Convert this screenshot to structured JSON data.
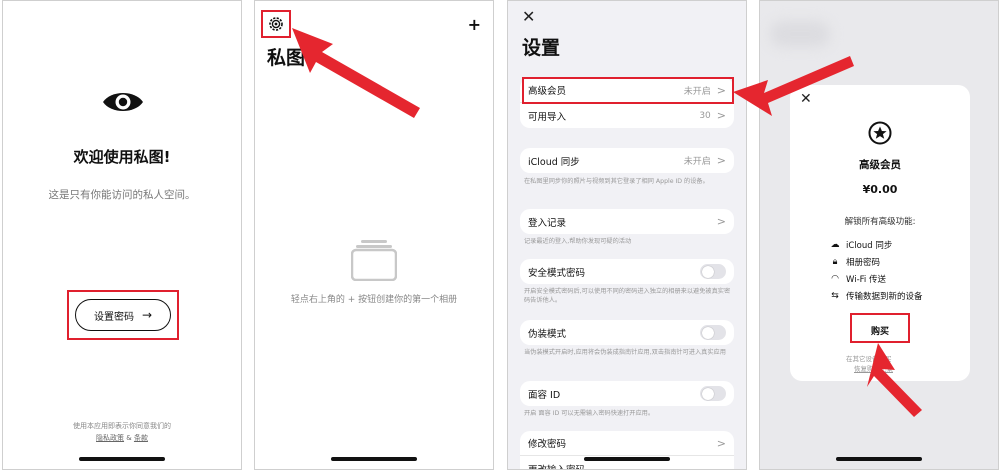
{
  "welcome": {
    "title": "欢迎使用私图!",
    "subtitle": "这是只有你能访问的私人空间。",
    "set_password_label": "设置密码",
    "arrow": "→",
    "footer_line1": "使用本应用即表示你同意我们的",
    "footer_privacy": "隐私政策",
    "footer_and": " & ",
    "footer_terms": "条款"
  },
  "albums": {
    "title": "私图",
    "add_symbol": "+",
    "empty_hint": "轻点右上角的 + 按钮创建你的第一个相册"
  },
  "settings": {
    "close_symbol": "✕",
    "title": "设置",
    "chev": ">",
    "premium_label": "高级会员",
    "premium_value": "未开启",
    "imports_label": "可用导入",
    "imports_value": "30",
    "icloud_label": "iCloud 同步",
    "icloud_value": "未开启",
    "icloud_note": "在私图里同步你的照片与视频到其它登录了相同 Apple ID 的设备。",
    "login_label": "登入记录",
    "login_note": "记录最近的登入,帮助你发现可疑的活动",
    "safe_label": "安全模式密码",
    "safe_note": "开启安全模式密码后,可以使用不同的密码进入独立的相册来以避免被真实密码告诉他人。",
    "fake_label": "伪装模式",
    "fake_note": "当伪装模式开启时,应用将会伪装成指南针应用,双击指南针可进入真实应用",
    "faceid_label": "面容 ID",
    "faceid_note": "开启 面容 ID 可以无需输入密码快速打开应用。",
    "change_label": "修改密码",
    "partial_label": "更改输入密码"
  },
  "purchase": {
    "close_symbol": "✕",
    "title": "高级会员",
    "price": "¥0.00",
    "unlock_text": "解锁所有高级功能:",
    "features": [
      "iCloud 同步",
      "相册密码",
      "Wi-Fi 传送",
      "传输数据到新的设备"
    ],
    "buy_label": "购买",
    "foot1": "在其它设备购买",
    "foot2": "恢复购买记录"
  },
  "colors": {
    "highlight": "#e0202e",
    "arrow": "#e5262f"
  }
}
